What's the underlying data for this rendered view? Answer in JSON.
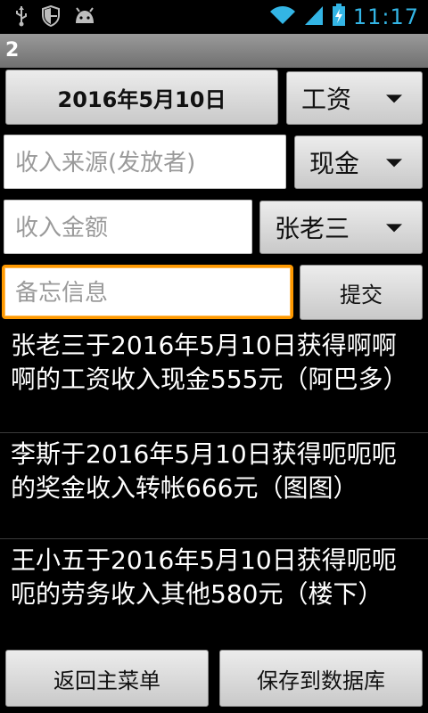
{
  "status_bar": {
    "time": "11:17",
    "left_icons": [
      "usb-icon",
      "shield-icon",
      "android-icon"
    ],
    "right_icons": [
      "wifi-icon",
      "signal-icon",
      "battery-charging-icon"
    ]
  },
  "title": "2",
  "form": {
    "date_button": "2016年5月10日",
    "type_spinner": "工资",
    "source_input_placeholder": "收入来源(发放者)",
    "method_spinner": "现金",
    "amount_input_placeholder": "收入金额",
    "person_spinner": "张老三",
    "memo_input_placeholder": "备忘信息",
    "submit_button": "提交"
  },
  "records": [
    "张老三于2016年5月10日获得啊啊啊的工资收入现金555元（阿巴多）",
    "李斯于2016年5月10日获得呃呃呃的奖金收入转帐666元（图图）",
    "王小五于2016年5月10日获得呃呃呃的劳务收入其他580元（楼下）"
  ],
  "bottom": {
    "back_button": "返回主菜单",
    "save_button": "保存到数据库"
  }
}
